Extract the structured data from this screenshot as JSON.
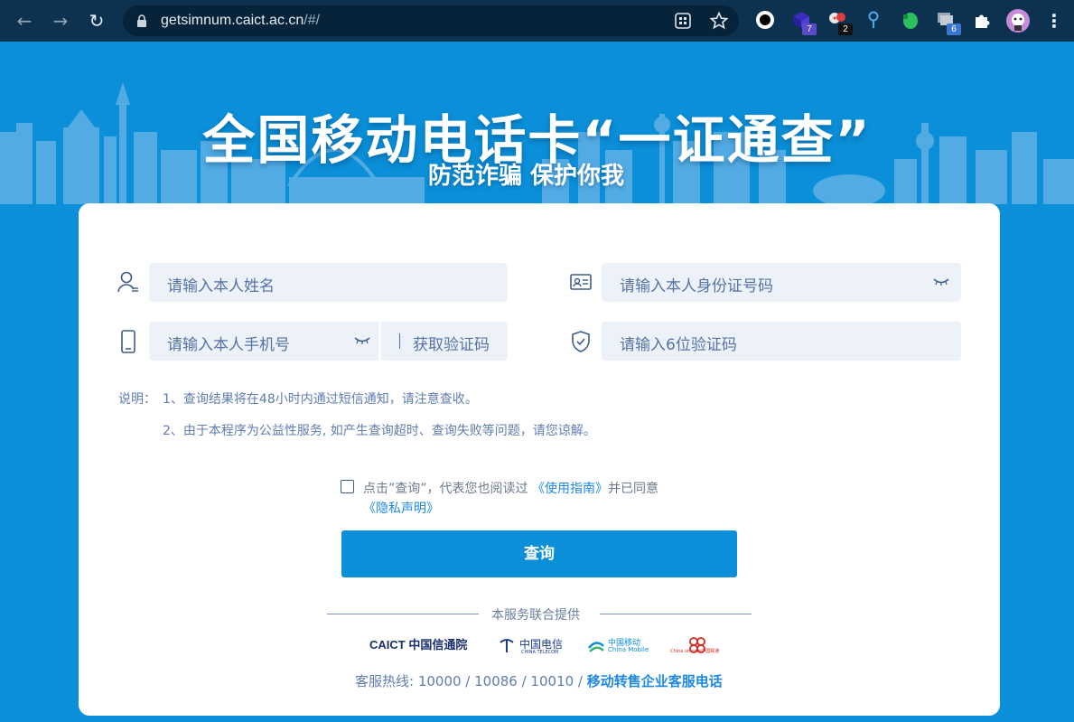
{
  "browser": {
    "url_host": "getsimnum.caict.ac.cn",
    "url_path": "/#/",
    "ext_badges": [
      "7",
      "2",
      "6"
    ]
  },
  "banner": {
    "title": "全国移动电话卡“一证通查”",
    "subtitle": "防范诈骗 保护你我"
  },
  "form": {
    "name_placeholder": "请输入本人姓名",
    "id_placeholder": "请输入本人身份证号码",
    "phone_placeholder": "请输入本人手机号",
    "get_code_label": "获取验证码",
    "code_placeholder": "请输入6位验证码"
  },
  "notes": {
    "label": "说明：",
    "line1": "1、查询结果将在48小时内通过短信通知，请注意查收。",
    "line2": "2、由于本程序为公益性服务, 如产生查询超时、查询失败等问题，请您谅解。"
  },
  "agreement": {
    "prefix": "点击”查询”，代表您也阅读过",
    "guide_link": "《使用指南》",
    "middle": "并已同意",
    "privacy_link": "《隐私声明》"
  },
  "query_button": "查询",
  "footer": {
    "provided_by": "本服务联合提供",
    "logos": {
      "caict": "CAICT 中国信通院",
      "telecom": "中国电信",
      "telecom_en": "CHINA TELECOM",
      "mobile": "中国移动",
      "mobile_en": "China Mobile",
      "unicom": "China unicom中国联通"
    },
    "hotline_label": "客服热线: 10000 / 10086 / 10010 /",
    "hotline_link": "移动转售企业客服电话"
  },
  "colors": {
    "banner_bg": "#0a8fd8",
    "button": "#0a8fd8",
    "link": "#1e88e5",
    "field_bg": "#edf1f8"
  }
}
